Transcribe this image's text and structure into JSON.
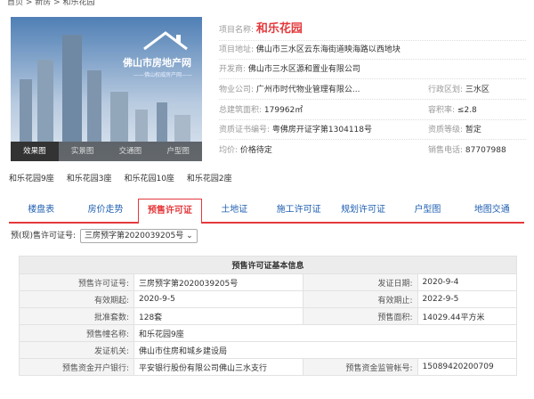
{
  "breadcrumb": "首页 > 新房 > 和乐花园",
  "hero": {
    "brand": "佛山市房地产网",
    "slogan": "——佛山权威房产网——",
    "tabs": [
      "效果图",
      "实景图",
      "交通图",
      "户型图"
    ],
    "active_tab": 0
  },
  "project": {
    "name_label": "项目名称:",
    "name": "和乐花园",
    "address_label": "项目地址:",
    "address": "佛山市三水区云东海街道映海路以西地块",
    "developer_label": "开发商:",
    "developer": "佛山市三水区源和置业有限公司",
    "property_label": "物业公司:",
    "property": "广州市时代物业管理有限公...",
    "district_label": "行政区划:",
    "district": "三水区",
    "area_label": "总建筑面积:",
    "area": "179962㎡",
    "far_label": "容积率:",
    "far": "≤2.8",
    "cert_label": "资质证书编号:",
    "cert": "粤佛房开证字第1304118号",
    "level_label": "资质等级:",
    "level": "暂定",
    "price_label": "均价:",
    "price": "价格待定",
    "phone_label": "销售电话:",
    "phone": "87707988"
  },
  "buildings": [
    "和乐花园9座",
    "和乐花园3座",
    "和乐花园10座",
    "和乐花园2座"
  ],
  "nav": {
    "tabs": [
      "楼盘表",
      "房价走势",
      "预售许可证",
      "土地证",
      "施工许可证",
      "规划许可证",
      "户型图",
      "地图交通"
    ],
    "active": 2
  },
  "permit_select": {
    "label": "预(现)售许可证号:",
    "value": "三房预字第2020039205号"
  },
  "permit_table": {
    "title": "预售许可证基本信息",
    "permit_no_label": "预售许可证号:",
    "permit_no": "三房预字第2020039205号",
    "issue_date_label": "发证日期:",
    "issue_date": "2020-9-4",
    "valid_from_label": "有效期起:",
    "valid_from": "2020-9-5",
    "valid_to_label": "有效期止:",
    "valid_to": "2022-9-5",
    "units_label": "批准套数:",
    "units": "128套",
    "presale_area_label": "预售面积:",
    "presale_area": "14029.44平方米",
    "building_label": "预售幢名称:",
    "building": "和乐花园9座",
    "authority_label": "发证机关:",
    "authority": "佛山市住房和城乡建设局",
    "bank_label": "预售资金开户银行:",
    "bank": "平安银行股份有限公司佛山三水支行",
    "account_label": "预售资金监管帐号:",
    "account": "15089420200709"
  },
  "colors": {
    "accent": "#e4393c",
    "link": "#1f5fb0"
  }
}
